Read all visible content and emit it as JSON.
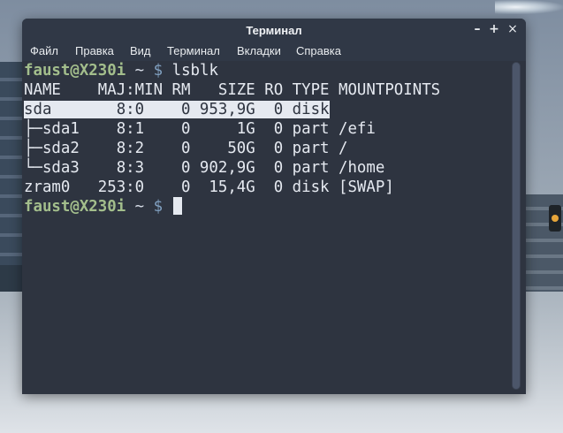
{
  "window": {
    "title": "Терминал",
    "controls": {
      "minimize": "–",
      "maximize": "+",
      "close": "×"
    }
  },
  "menubar": {
    "items": [
      "Файл",
      "Правка",
      "Вид",
      "Терминал",
      "Вкладки",
      "Справка"
    ]
  },
  "terminal": {
    "prompt": {
      "user_host": "faust@X230i",
      "path": "~",
      "symbol": "$"
    },
    "command": "lsblk",
    "lines": [
      "NAME    MAJ:MIN RM   SIZE RO TYPE MOUNTPOINTS",
      "sda       8:0    0 953,9G  0 disk",
      "├─sda1    8:1    0     1G  0 part /efi",
      "├─sda2    8:2    0    50G  0 part /",
      "└─sda3    8:3    0 902,9G  0 part /home",
      "zram0   253:0    0  15,4G  0 disk [SWAP]"
    ],
    "highlighted_line_index": 1
  },
  "colors": {
    "terminal_bg": "#2e3440",
    "prompt_green": "#a3be8c",
    "dollar_blue": "#81a1c1",
    "text": "#e5e9f0"
  }
}
